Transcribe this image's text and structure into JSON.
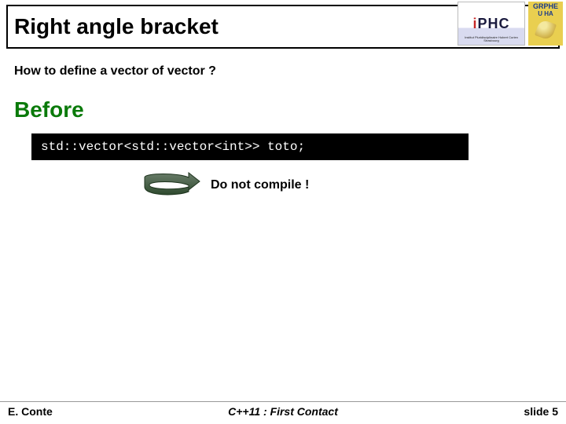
{
  "title": "Right angle bracket",
  "logos": {
    "iphc": "IPHC",
    "iphc_sub": "Institut Pluridisciplinaire Hubert Curien Strasbourg",
    "grphe_l1": "GRPHE",
    "grphe_l2": "U HA"
  },
  "question": "How to define a vector of vector ?",
  "before_label": "Before",
  "code": "std::vector<std::vector<int>> toto;",
  "no_compile": "Do not compile !",
  "footer": {
    "left": "E. Conte",
    "center": "C++11 : First Contact",
    "right": "slide 5"
  }
}
